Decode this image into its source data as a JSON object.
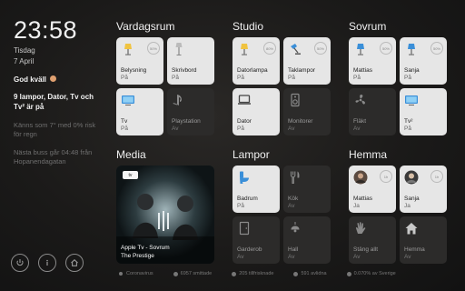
{
  "left": {
    "time": "23:58",
    "weekday": "Tisdag",
    "date": "7 April",
    "greeting": "God kväll",
    "summary": "9 lampor, Dator, Tv och Tv² är på",
    "weather": "Känns som 7° med 0% risk för regn",
    "bus": "Nästa buss går 04:48 från Hopanendagatan",
    "icons": [
      "power-icon",
      "info-icon",
      "home-icon"
    ]
  },
  "groups": {
    "vardagsrum": {
      "title": "Vardagsrum",
      "tiles": [
        {
          "name": "Belysning",
          "state": "På",
          "badge": "50%"
        },
        {
          "name": "Skrivbord",
          "state": "På"
        },
        {
          "name": "Tv",
          "state": "På"
        },
        {
          "name": "Playstation",
          "state": "Av"
        }
      ]
    },
    "studio": {
      "title": "Studio",
      "tiles": [
        {
          "name": "Datorlampa",
          "state": "På",
          "badge": "80%"
        },
        {
          "name": "Taklampor",
          "state": "På",
          "badge": "50%"
        },
        {
          "name": "Dator",
          "state": "På"
        },
        {
          "name": "Monitorer",
          "state": "Av"
        }
      ]
    },
    "sovrum": {
      "title": "Sovrum",
      "tiles": [
        {
          "name": "Mattias",
          "state": "På",
          "badge": "50%"
        },
        {
          "name": "Sanja",
          "state": "På",
          "badge": "50%"
        },
        {
          "name": "Fläkt",
          "state": "Av"
        },
        {
          "name": "Tv²",
          "state": "På"
        }
      ]
    },
    "media": {
      "title": "Media",
      "badge": "tv",
      "line1": "Apple Tv - Sovrum",
      "line2": "The Prestige"
    },
    "lampor": {
      "title": "Lampor",
      "tiles": [
        {
          "name": "Badrum",
          "state": "På"
        },
        {
          "name": "Kök",
          "state": "Av"
        },
        {
          "name": "Garderob",
          "state": "Av"
        },
        {
          "name": "Hall",
          "state": "Av"
        }
      ]
    },
    "hemma": {
      "title": "Hemma",
      "tiles": [
        {
          "name": "Mattias",
          "state": "Ja",
          "badge": "1h"
        },
        {
          "name": "Sanja",
          "state": "Ja",
          "badge": "1h"
        },
        {
          "name": "Stäng allt",
          "state": "Av"
        },
        {
          "name": "Hemma",
          "state": "Av"
        }
      ]
    }
  },
  "footer": {
    "corona": "Coronavirus",
    "infected": "6957 smittade",
    "deceased": "205 tillfrisknade",
    "deaths": "591 avlidna",
    "percent": "0.070% av Sverige"
  },
  "colors": {
    "tile_on": "#e6e6e6",
    "tile_off": "#2c2b2a",
    "accent_blue": "#3a8fd8",
    "bulb_yellow": "#f0c340"
  }
}
